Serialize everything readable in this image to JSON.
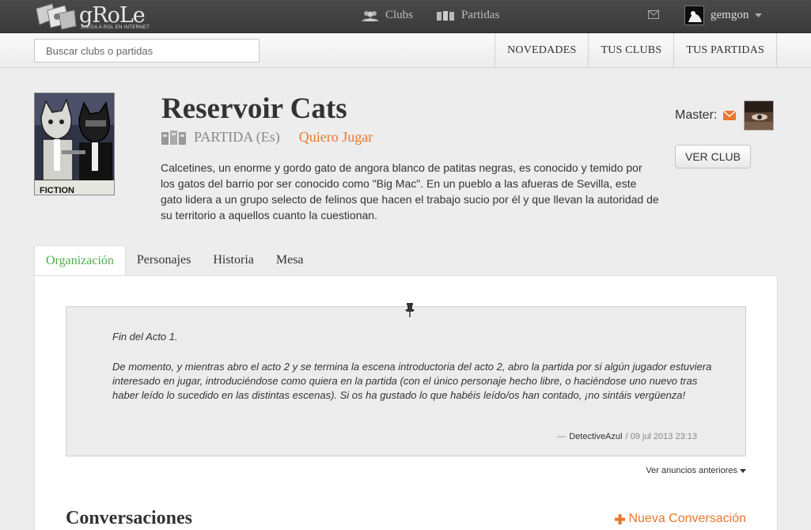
{
  "brand": {
    "name": "gRoLe",
    "tagline": "JUEGA A ROL EN INTERNET"
  },
  "topnav": {
    "clubs": "Clubs",
    "partidas": "Partidas",
    "username": "gemgon"
  },
  "search": {
    "placeholder": "Buscar clubs o partidas"
  },
  "subnav": [
    "NOVEDADES",
    "TUS CLUBS",
    "TUS PARTIDAS"
  ],
  "game": {
    "title": "Reservoir Cats",
    "type": "PARTIDA (Es)",
    "join": "Quiero Jugar",
    "image_caption": "FICTION",
    "description": "Calcetines, un enorme y gordo gato de angora blanco de patitas negras, es conocido y temido por los gatos del barrio por ser conocido como \"Big Mac\". En un pueblo a las afueras de Sevilla, este gato lidera a un grupo selecto de felinos que hacen el trabajo sucio por él y que llevan la autoridad de su territorio a aquellos cuanto la cuestionan."
  },
  "master": {
    "label": "Master:",
    "button": "VER CLUB"
  },
  "tabs": [
    "Organización",
    "Personajes",
    "Historia",
    "Mesa"
  ],
  "announcement": {
    "p1": "Fin del Acto 1.",
    "p2": "De momento, y mientras abro el acto 2 y se termina la escena introductoria del acto 2, abro la partida por si algún jugador estuviera interesado en jugar, introduciéndose como quiera en la partida (con el único personaje hecho libre, o haciéndose uno nuevo tras haber leído lo sucedido en las distintas escenas). Si os ha gustado lo que habéis leído/os han contado, ¡no sintáis vergüenza!",
    "dash": "—",
    "author": "DetectiveAzul",
    "date": "/ 09 jul 2013 23:13",
    "prev": "Ver anuncios anteriores"
  },
  "conversations": {
    "title": "Conversaciones",
    "new": "Nueva Conversación"
  },
  "colors": {
    "accent": "#e9772d",
    "active_tab": "#4cae4c",
    "topbar": "#404040"
  }
}
